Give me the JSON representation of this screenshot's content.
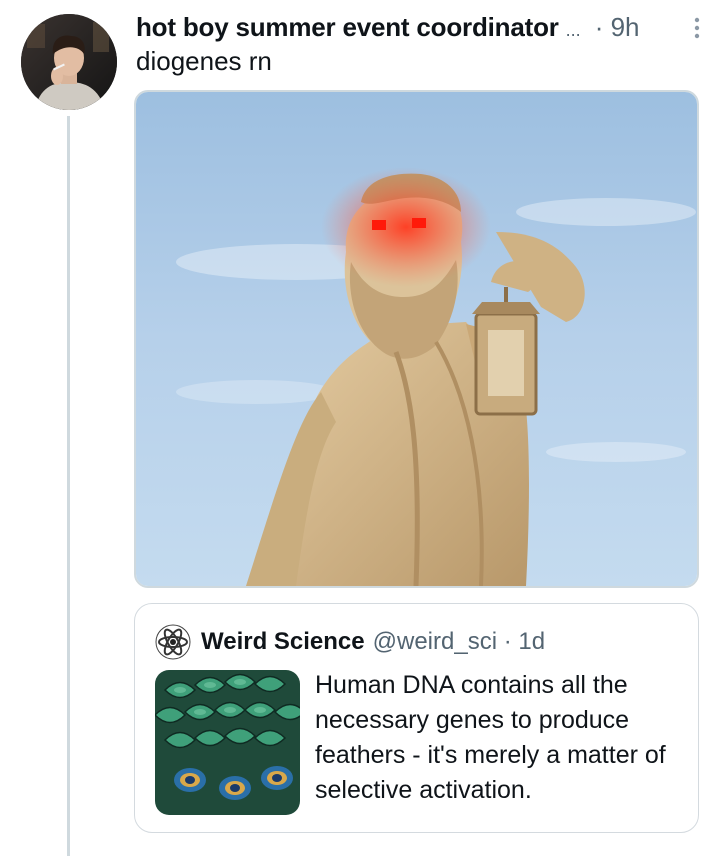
{
  "tweet": {
    "author_name": "hot boy summer event coordinator",
    "name_truncation": "...",
    "timestamp": "· 9h",
    "text": "diogenes rn",
    "more_icon": "vertical-dots-icon",
    "avatar": "user-avatar-photo",
    "media": "diogenes-statue-glowing-eyes-photo"
  },
  "quote": {
    "author_name": "Weird Science",
    "handle_time": "@weird_sci · 1d",
    "text": "Human DNA contains all the necessary genes to produce feathers - it's merely a matter of selective activation.",
    "avatar": "atom-logo",
    "thumbnail": "peacock-feathers-photo"
  },
  "colors": {
    "primary_text": "#0f1419",
    "secondary_text": "#536471",
    "border": "#cfd9de",
    "sky": "#a9c9e6",
    "statue": "#d2b98a",
    "eye_glow": "#ff2a1a"
  }
}
